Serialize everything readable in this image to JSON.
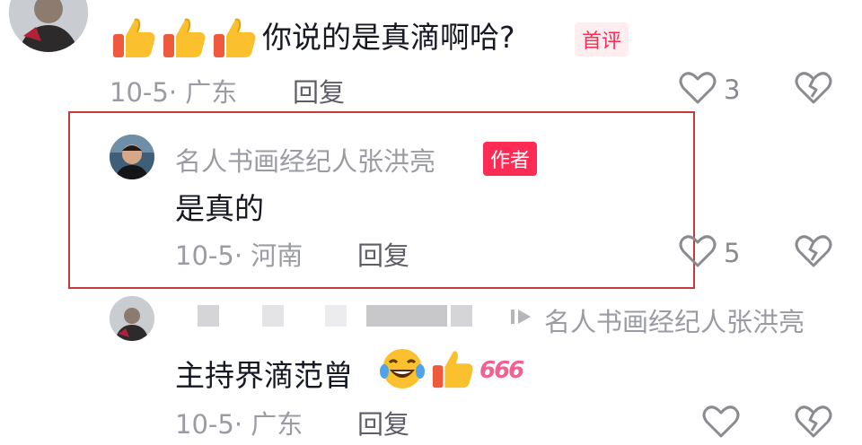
{
  "comment1": {
    "emojis": [
      "thumbs-up",
      "thumbs-up",
      "thumbs-up"
    ],
    "text": "你说的是真滴啊哈?",
    "badge": "首评",
    "date_location": "10-5· 广东",
    "reply_label": "回复",
    "like_count": "3"
  },
  "reply1": {
    "username": "名人书画经纪人张洪亮",
    "badge": "作者",
    "text": "是真的",
    "date_location": "10-5· 河南",
    "reply_label": "回复",
    "like_count": "5"
  },
  "reply2": {
    "reply_to": "名人书画经纪人张洪亮",
    "text": "主持界滴范曾",
    "emoji_text": "666",
    "date_location": "10-5· 广东",
    "reply_label": "回复"
  },
  "colors": {
    "accent": "#fe2c55",
    "meta_gray": "#9b9ca3",
    "highlight_border": "#c53a3a"
  }
}
